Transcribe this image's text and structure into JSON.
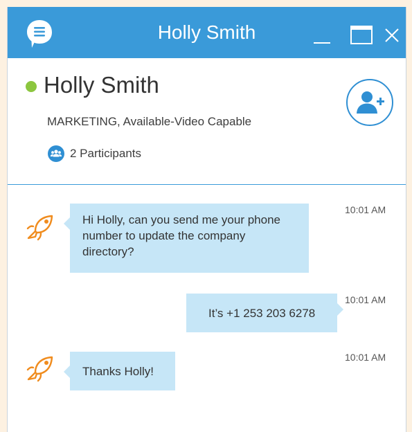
{
  "window": {
    "title": "Holly Smith",
    "controls": [
      "minimize-icon",
      "maximize-icon",
      "close-icon"
    ],
    "accent_color": "#3a9ad9"
  },
  "contact": {
    "name": "Holly Smith",
    "status_color": "#8cc63f",
    "department_status": "MARKETING, Available-Video Capable",
    "participants_label": "2 Participants"
  },
  "messages": [
    {
      "direction": "incoming",
      "avatar_icon": "fish-icon",
      "text": "Hi Holly, can you send me your phone number to update the company directory?",
      "time": "10:01 AM"
    },
    {
      "direction": "outgoing",
      "text": "It’s +1 253 203 6278",
      "time": "10:01 AM"
    },
    {
      "direction": "incoming",
      "avatar_icon": "fish-icon",
      "text": "Thanks Holly!",
      "time": "10:01 AM"
    }
  ]
}
